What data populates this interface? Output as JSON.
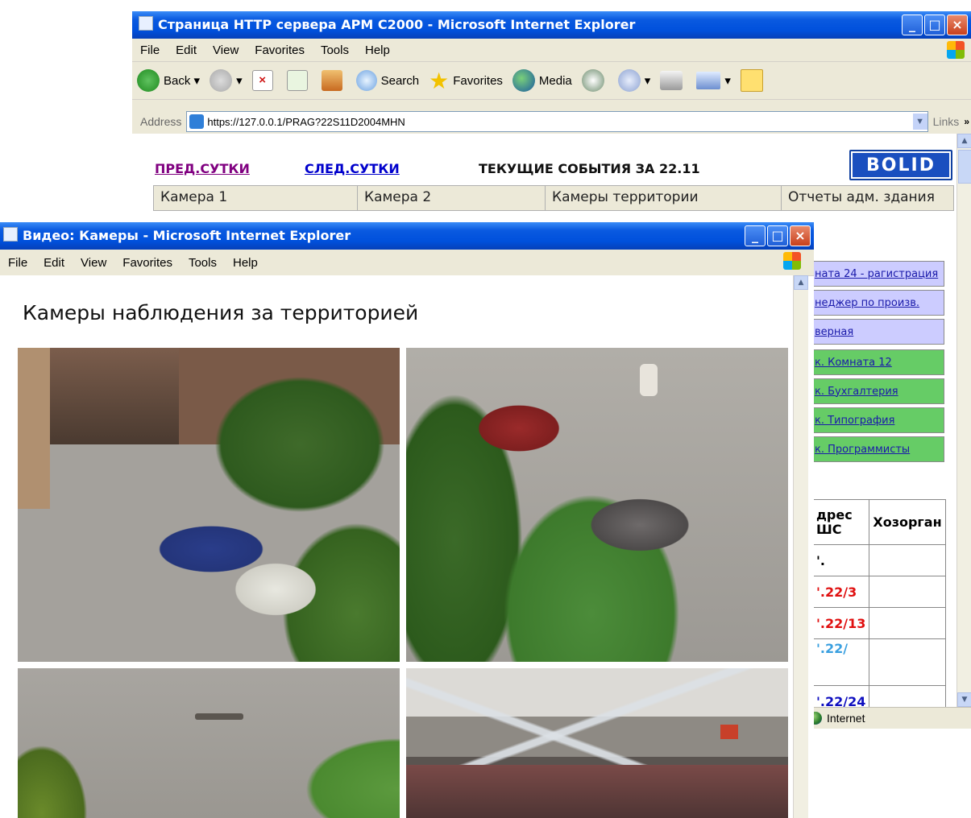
{
  "back_window": {
    "title": "Страница HTTP сервера АРМ С2000 - Microsoft Internet Explorer",
    "menu": [
      "File",
      "Edit",
      "View",
      "Favorites",
      "Tools",
      "Help"
    ],
    "toolbar": {
      "back": "Back",
      "search": "Search",
      "favorites": "Favorites",
      "media": "Media"
    },
    "address_label": "Address",
    "address_value": "https://127.0.0.1/PRAG?22S11D2004MHN",
    "links_label": "Links",
    "nav": {
      "prev": "ПРЕД.СУТКИ",
      "next": "СЛЕД.СУТКИ",
      "current": "ТЕКУЩИЕ СОБЫТИЯ ЗА 22.11"
    },
    "logo": "BOLID",
    "tabs": [
      "Камера 1",
      "Камера 2",
      "Камеры территории",
      "Отчеты адм. здания"
    ],
    "right_links": [
      {
        "text": "ната 24 - рагистрация",
        "color": "#ccccff"
      },
      {
        "text": "неджер по произв.",
        "color": "#ccccff"
      },
      {
        "text": "верная",
        "color": "#ccccff"
      },
      {
        "text": "к. Комната 12",
        "color": "#66cc66"
      },
      {
        "text": "к. Бухгалтерия",
        "color": "#66cc66"
      },
      {
        "text": "к. Типография",
        "color": "#66cc66"
      },
      {
        "text": "к. Программисты",
        "color": "#66cc66"
      }
    ],
    "table": {
      "headers": [
        "дрес ШС",
        "Хозорган"
      ],
      "rows": [
        {
          "addr": "'.",
          "color": "#000000"
        },
        {
          "addr": "'.22/3",
          "color": "#e01010"
        },
        {
          "addr": "'.22/13",
          "color": "#e01010"
        },
        {
          "addr": "'.22/",
          "color": "#3aa0e0"
        },
        {
          "addr": "'.22/24",
          "color": "#1010c0"
        }
      ]
    },
    "status_zone": "Internet"
  },
  "front_window": {
    "title": "Видео: Камеры  - Microsoft Internet Explorer",
    "menu": [
      "File",
      "Edit",
      "View",
      "Favorites",
      "Tools",
      "Help"
    ],
    "heading": "Камеры наблюдения за территорией"
  },
  "colors": {
    "link_prev": "#800080",
    "link_next": "#0000cc",
    "xp_blue": "#0a5ae0"
  }
}
